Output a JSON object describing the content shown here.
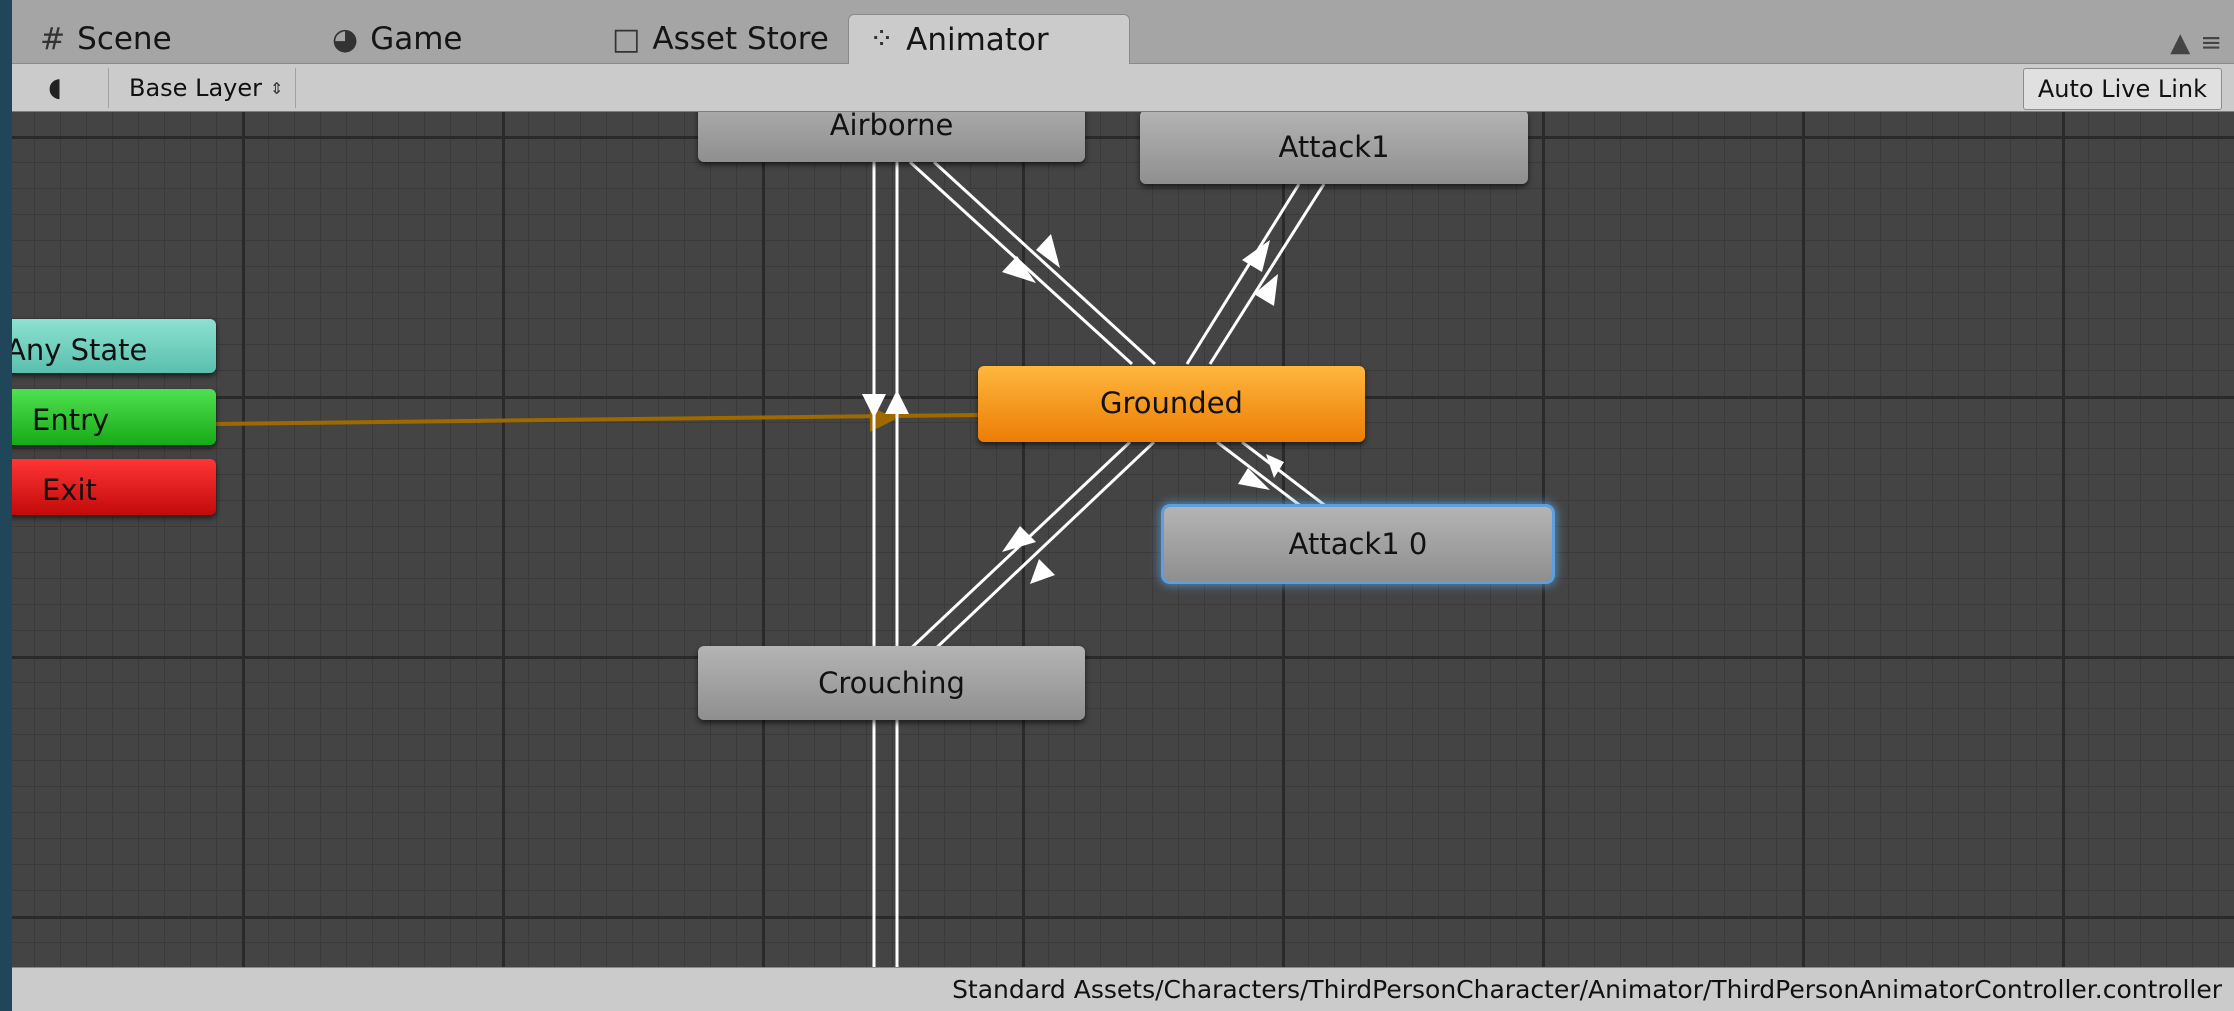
{
  "tabs": [
    {
      "label": "Scene",
      "icon": "grid-icon"
    },
    {
      "label": "Game",
      "icon": "pacman-icon"
    },
    {
      "label": "Asset Store",
      "icon": "shopping-bag-icon"
    },
    {
      "label": "Animator",
      "icon": "animator-icon",
      "active": true
    }
  ],
  "toolbar": {
    "layer": "Base Layer",
    "live_link": "Auto Live Link"
  },
  "graph": {
    "nodes": {
      "airborne": "Airborne",
      "attack1": "Attack1",
      "any_state": "Any State",
      "entry": "Entry",
      "exit": "Exit",
      "grounded": "Grounded",
      "attack1_0": "Attack1 0",
      "crouching": "Crouching"
    },
    "colors": {
      "state": "#a6a6a6",
      "default_state": "#f5990f",
      "any_state": "#74d0c0",
      "entry": "#2bc22b",
      "exit": "#e01616",
      "selected_outline": "#5b9fdc",
      "transition": "#ffffff",
      "entry_transition": "#9e6a00"
    }
  },
  "status": {
    "path": "Standard Assets/Characters/ThirdPersonCharacter/Animator/ThirdPersonAnimatorController.controller"
  }
}
